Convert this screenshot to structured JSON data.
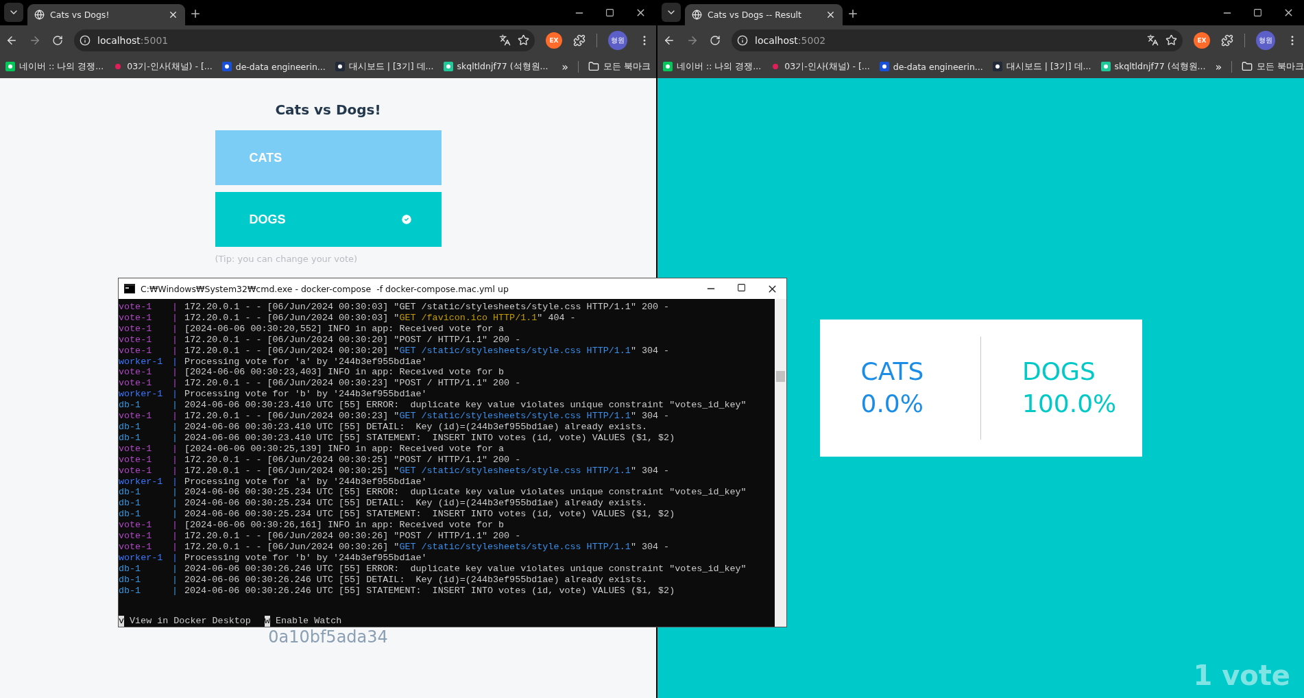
{
  "browsers": [
    {
      "tab": {
        "title": "Cats vs Dogs!"
      },
      "address": {
        "host": "localhost",
        "port": ":5001"
      },
      "profile": "형원",
      "extension": "EX",
      "bookmarks": [
        {
          "kind": "naver",
          "label": "네이버 :: 나의 경쟁..."
        },
        {
          "kind": "slack",
          "label": "03기-인사(채널) - [..."
        },
        {
          "kind": "square",
          "label": "de-data engineerin..."
        },
        {
          "kind": "bird",
          "label": "대시보드 | [3기] 데..."
        },
        {
          "kind": "vee",
          "label": "skqltldnjf77 (석형원..."
        }
      ],
      "overflow": "»",
      "all_bookmarks": "모든 북마크",
      "page": {
        "kind": "vote",
        "title": "Cats vs Dogs!",
        "options": [
          {
            "label": "CATS",
            "color": "#7ccdf6",
            "selected": false
          },
          {
            "label": "DOGS",
            "color": "#00cbca",
            "selected": true
          }
        ],
        "tip": "(Tip: you can change your vote)",
        "hostname": "0a10bf5ada34"
      }
    },
    {
      "tab": {
        "title": "Cats vs Dogs -- Result"
      },
      "address": {
        "host": "localhost",
        "port": ":5002"
      },
      "profile": "형원",
      "extension": "EX",
      "bookmarks": [
        {
          "kind": "naver",
          "label": "네이버 :: 나의 경쟁..."
        },
        {
          "kind": "slack",
          "label": "03기-인사(채널) - [..."
        },
        {
          "kind": "square",
          "label": "de-data engineerin..."
        },
        {
          "kind": "bird",
          "label": "대시보드 | [3기] 데..."
        },
        {
          "kind": "vee",
          "label": "skqltldnjf77 (석형원..."
        }
      ],
      "overflow": "»",
      "all_bookmarks": "모든 북마크",
      "page": {
        "kind": "result",
        "results": [
          {
            "label": "CATS",
            "percent": "0.0%",
            "color": "#1b8de6"
          },
          {
            "label": "DOGS",
            "percent": "100.0%",
            "color": "#00c9c8"
          }
        ],
        "votes": "1 vote"
      }
    }
  ],
  "terminal": {
    "title": "C:₩Windows₩System32₩cmd.exe - docker-compose  -f docker-compose.mac.yml up",
    "separator": "|",
    "lines": [
      {
        "service": "vote-1",
        "color": "#b148c6",
        "parts": [
          {
            "kind": "plain",
            "text": "172.20.0.1 - - [06/Jun/2024 00:30:03] \"GET /static/stylesheets/style.css HTTP/1.1\" 200 -"
          }
        ]
      },
      {
        "service": "vote-1",
        "color": "#b148c6",
        "parts": [
          {
            "kind": "plain",
            "text": "172.20.0.1 - - [06/Jun/2024 00:30:03] \""
          },
          {
            "kind": "warn",
            "text": "GET /favicon.ico HTTP/1.1"
          },
          {
            "kind": "plain",
            "text": "\" 404 -"
          }
        ]
      },
      {
        "service": "vote-1",
        "color": "#b148c6",
        "parts": [
          {
            "kind": "plain",
            "text": "[2024-06-06 00:30:20,552] INFO in app: Received vote for a"
          }
        ]
      },
      {
        "service": "vote-1",
        "color": "#b148c6",
        "parts": [
          {
            "kind": "plain",
            "text": "172.20.0.1 - - [06/Jun/2024 00:30:20] \"POST / HTTP/1.1\" 200 -"
          }
        ]
      },
      {
        "service": "vote-1",
        "color": "#b148c6",
        "parts": [
          {
            "kind": "plain",
            "text": "172.20.0.1 - - [06/Jun/2024 00:30:20] \""
          },
          {
            "kind": "url",
            "text": "GET /static/stylesheets/style.css HTTP/1.1"
          },
          {
            "kind": "plain",
            "text": "\" 304 -"
          }
        ]
      },
      {
        "service": "worker-1",
        "color": "#3b78ff",
        "parts": [
          {
            "kind": "plain",
            "text": "Processing vote for 'a' by '244b3ef955bd1ae'"
          }
        ]
      },
      {
        "service": "vote-1",
        "color": "#b148c6",
        "parts": [
          {
            "kind": "plain",
            "text": "[2024-06-06 00:30:23,403] INFO in app: Received vote for b"
          }
        ]
      },
      {
        "service": "vote-1",
        "color": "#b148c6",
        "parts": [
          {
            "kind": "plain",
            "text": "172.20.0.1 - - [06/Jun/2024 00:30:23] \"POST / HTTP/1.1\" 200 -"
          }
        ]
      },
      {
        "service": "worker-1",
        "color": "#3b78ff",
        "parts": [
          {
            "kind": "plain",
            "text": "Processing vote for 'b' by '244b3ef955bd1ae'"
          }
        ]
      },
      {
        "service": "db-1",
        "color": "#3a96dd",
        "parts": [
          {
            "kind": "plain",
            "text": "2024-06-06 00:30:23.410 UTC [55] ERROR:  duplicate key value violates unique constraint \"votes_id_key\""
          }
        ]
      },
      {
        "service": "vote-1",
        "color": "#b148c6",
        "parts": [
          {
            "kind": "plain",
            "text": "172.20.0.1 - - [06/Jun/2024 00:30:23] \""
          },
          {
            "kind": "url",
            "text": "GET /static/stylesheets/style.css HTTP/1.1"
          },
          {
            "kind": "plain",
            "text": "\" 304 -"
          }
        ]
      },
      {
        "service": "db-1",
        "color": "#3a96dd",
        "parts": [
          {
            "kind": "plain",
            "text": "2024-06-06 00:30:23.410 UTC [55] DETAIL:  Key (id)=(244b3ef955bd1ae) already exists."
          }
        ]
      },
      {
        "service": "db-1",
        "color": "#3a96dd",
        "parts": [
          {
            "kind": "plain",
            "text": "2024-06-06 00:30:23.410 UTC [55] STATEMENT:  INSERT INTO votes (id, vote) VALUES ($1, $2)"
          }
        ]
      },
      {
        "service": "vote-1",
        "color": "#b148c6",
        "parts": [
          {
            "kind": "plain",
            "text": "[2024-06-06 00:30:25,139] INFO in app: Received vote for a"
          }
        ]
      },
      {
        "service": "vote-1",
        "color": "#b148c6",
        "parts": [
          {
            "kind": "plain",
            "text": "172.20.0.1 - - [06/Jun/2024 00:30:25] \"POST / HTTP/1.1\" 200 -"
          }
        ]
      },
      {
        "service": "vote-1",
        "color": "#b148c6",
        "parts": [
          {
            "kind": "plain",
            "text": "172.20.0.1 - - [06/Jun/2024 00:30:25] \""
          },
          {
            "kind": "url",
            "text": "GET /static/stylesheets/style.css HTTP/1.1"
          },
          {
            "kind": "plain",
            "text": "\" 304 -"
          }
        ]
      },
      {
        "service": "worker-1",
        "color": "#3b78ff",
        "parts": [
          {
            "kind": "plain",
            "text": "Processing vote for 'a' by '244b3ef955bd1ae'"
          }
        ]
      },
      {
        "service": "db-1",
        "color": "#3a96dd",
        "parts": [
          {
            "kind": "plain",
            "text": "2024-06-06 00:30:25.234 UTC [55] ERROR:  duplicate key value violates unique constraint \"votes_id_key\""
          }
        ]
      },
      {
        "service": "db-1",
        "color": "#3a96dd",
        "parts": [
          {
            "kind": "plain",
            "text": "2024-06-06 00:30:25.234 UTC [55] DETAIL:  Key (id)=(244b3ef955bd1ae) already exists."
          }
        ]
      },
      {
        "service": "db-1",
        "color": "#3a96dd",
        "parts": [
          {
            "kind": "plain",
            "text": "2024-06-06 00:30:25.234 UTC [55] STATEMENT:  INSERT INTO votes (id, vote) VALUES ($1, $2)"
          }
        ]
      },
      {
        "service": "vote-1",
        "color": "#b148c6",
        "parts": [
          {
            "kind": "plain",
            "text": "[2024-06-06 00:30:26,161] INFO in app: Received vote for b"
          }
        ]
      },
      {
        "service": "vote-1",
        "color": "#b148c6",
        "parts": [
          {
            "kind": "plain",
            "text": "172.20.0.1 - - [06/Jun/2024 00:30:26] \"POST / HTTP/1.1\" 200 -"
          }
        ]
      },
      {
        "service": "vote-1",
        "color": "#b148c6",
        "parts": [
          {
            "kind": "plain",
            "text": "172.20.0.1 - - [06/Jun/2024 00:30:26] \""
          },
          {
            "kind": "url",
            "text": "GET /static/stylesheets/style.css HTTP/1.1"
          },
          {
            "kind": "plain",
            "text": "\" 304 -"
          }
        ]
      },
      {
        "service": "worker-1",
        "color": "#3b78ff",
        "parts": [
          {
            "kind": "plain",
            "text": "Processing vote for 'b' by '244b3ef955bd1ae'"
          }
        ]
      },
      {
        "service": "db-1",
        "color": "#3a96dd",
        "parts": [
          {
            "kind": "plain",
            "text": "2024-06-06 00:30:26.246 UTC [55] ERROR:  duplicate key value violates unique constraint \"votes_id_key\""
          }
        ]
      },
      {
        "service": "db-1",
        "color": "#3a96dd",
        "parts": [
          {
            "kind": "plain",
            "text": "2024-06-06 00:30:26.246 UTC [55] DETAIL:  Key (id)=(244b3ef955bd1ae) already exists."
          }
        ]
      },
      {
        "service": "db-1",
        "color": "#3a96dd",
        "parts": [
          {
            "kind": "plain",
            "text": "2024-06-06 00:30:26.246 UTC [55] STATEMENT:  INSERT INTO votes (id, vote) VALUES ($1, $2)"
          }
        ]
      }
    ],
    "shortcuts": [
      {
        "key": "v",
        "label": "View in Docker Desktop"
      },
      {
        "key": "w",
        "label": "Enable Watch"
      }
    ]
  }
}
